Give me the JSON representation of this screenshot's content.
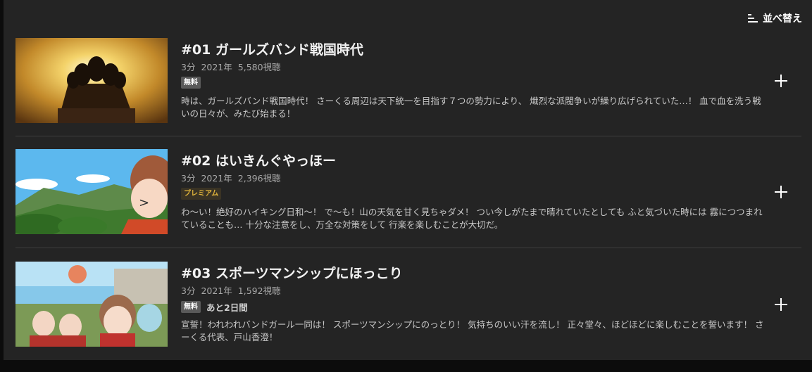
{
  "toolbar": {
    "sort_label": "並べ替え",
    "sort_icon": "sort-icon"
  },
  "episodes": [
    {
      "title": "#01 ガールズバンド戦国時代",
      "duration": "3分",
      "year": "2021年",
      "views": "5,580視聴",
      "badge": "無料",
      "badge_type": "free",
      "remaining": "",
      "description": "時は、ガールズバンド戦国時代！ さーくる周辺は天下統一を目指す７つの勢力により、 熾烈な派閥争いが繰り広げられていた…！ 血で血を洗う戦いの日々が、みたび始まる！"
    },
    {
      "title": "#02 はいきんぐやっほー",
      "duration": "3分",
      "year": "2021年",
      "views": "2,396視聴",
      "badge": "プレミアム",
      "badge_type": "premium",
      "remaining": "",
      "description": "わ〜い！絶好のハイキング日和〜！ で〜も！山の天気を甘く見ちゃダメ！ つい今しがたまで晴れていたとしても ふと気づいた時には 霧につつまれていることも… 十分な注意をし、万全な対策をして 行楽を楽しむことが大切だ。"
    },
    {
      "title": "#03 スポーツマンシップにほっこり",
      "duration": "3分",
      "year": "2021年",
      "views": "1,592視聴",
      "badge": "無料",
      "badge_type": "free",
      "remaining": "あと2日間",
      "description": "宣誓！われわれバンドガール一同は！ スポーツマンシップにのっとり！ 気持ちのいい汗を流し！ 正々堂々、ほどほどに楽しむことを誓います！ さーくる代表、戸山香澄！"
    }
  ],
  "colors": {
    "background": "#242424",
    "premium": "#e0b43c",
    "free_badge": "#5a5a5a"
  }
}
